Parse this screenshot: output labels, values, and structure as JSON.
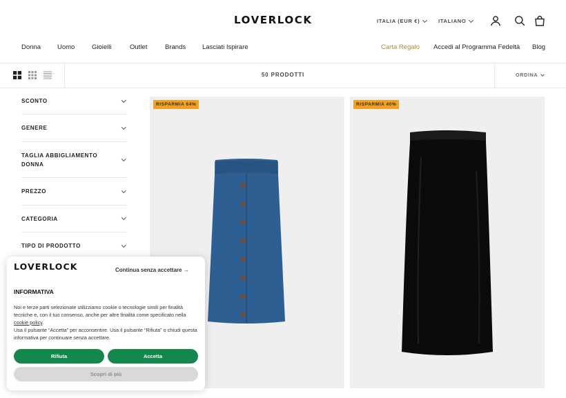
{
  "header": {
    "logo": "LOVERLOCK",
    "country": "ITALIA (EUR €)",
    "language": "ITALIANO",
    "icons": [
      "account-icon",
      "search-icon",
      "bag-icon"
    ]
  },
  "main_nav": [
    "Donna",
    "Uomo",
    "Gioielli",
    "Outlet",
    "Brands",
    "Lasciati Ispirare"
  ],
  "secondary_nav": {
    "gift_card": "Carta Regalo",
    "loyalty": "Accedi al Programma Fedeltà",
    "blog": "Blog"
  },
  "colors": {
    "gift_card": "#b0893b",
    "badge": "#f0a022",
    "consent_green": "#14874d"
  },
  "toolbar": {
    "view_icons": [
      "grid-2-icon",
      "grid-4-icon",
      "list-icon"
    ],
    "product_count": "50 PRODOTTI",
    "sort_label": "ORDINA"
  },
  "filters": [
    "SCONTO",
    "GENERE",
    "TAGLIA ABBIGLIAMENTO DONNA",
    "PREZZO",
    "CATEGORIA",
    "TIPO DI PRODOTTO"
  ],
  "products": [
    {
      "badge": "RISPARMIA 64%",
      "image": "blue-knit-pencil-skirt"
    },
    {
      "badge": "RISPARMIA 40%",
      "image": "black-pencil-skirt"
    }
  ],
  "cookie_banner": {
    "logo": "LOVERLOCK",
    "continue_link": "Continua senza accettare →",
    "title": "INFORMATIVA",
    "text_1": "Noi e terze parti selezionate utilizziamo cookie o tecnologie simili per finalità tecniche e, con il tuo consenso, anche per altre finalità come specificato nella ",
    "policy_link": "cookie policy",
    "text_1_end": ".",
    "text_2": "Usa il pulsante “Accetta” per acconsentire. Usa il pulsante “Rifiuta” o chiudi questa informativa per continuare senza accettare.",
    "reject": "Rifiuta",
    "accept": "Accetta",
    "more": "Scopri di più"
  }
}
